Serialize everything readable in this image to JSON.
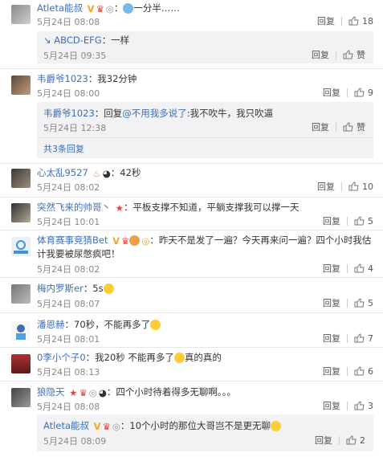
{
  "comments": [
    {
      "name": "Atleta能叔",
      "text": "：",
      "tail": "一分半……",
      "time": "5月24日 08:08",
      "reply": "回复",
      "likes": "18"
    },
    {
      "sub_name": "ABCD-EFG",
      "sub_text": "：一样",
      "sub_time": "5月24日 09:35",
      "reply": "回复",
      "likes": "赞"
    },
    {
      "name": "韦爵爷1023",
      "text": "：我32分钟",
      "time": "5月24日 08:00",
      "reply": "回复",
      "likes": "9"
    },
    {
      "sub_name": "韦爵爷1023",
      "sub_pre": "：回复",
      "sub_at": "@不用我多说了",
      "sub_text": ":我不吹牛，我只吹逼",
      "sub_time": "5月24日 12:38",
      "reply": "回复",
      "likes": "赞",
      "more": "共3条回复"
    },
    {
      "name": "心太乱9527",
      "text": "：42秒",
      "time": "5月24日 08:02",
      "reply": "回复",
      "likes": "10"
    },
    {
      "name": "突然飞来的帅哥丶",
      "text": "：平板支撑不知道，平躺支撑我可以撑一天",
      "time": "5月24日 10:01",
      "reply": "回复",
      "likes": "5"
    },
    {
      "name": "体育赛事竞猜Bet",
      "text": "：昨天不是发了一遍？今天再来问一遍？四个小时我估计我要被尿憋疯吧！",
      "time": "5月24日 08:02",
      "reply": "回复",
      "likes": "4"
    },
    {
      "name": "梅内罗斯er",
      "text": "：5s",
      "time": "5月24日 08:07",
      "reply": "回复",
      "likes": "5"
    },
    {
      "name": "潘恩赫",
      "text": "：70秒，不能再多了",
      "time": "5月24日 08:01",
      "reply": "回复",
      "likes": "7"
    },
    {
      "name": "0李小个子0",
      "text": "：我20秒 不能再多了",
      "tail": "真的真的",
      "time": "5月24日 08:13",
      "reply": "回复",
      "likes": "6"
    },
    {
      "name": "狼隐天",
      "text": "：四个小时待着得多无聊啊。。。",
      "time": "5月24日 08:08",
      "reply": "回复",
      "likes": "3"
    },
    {
      "sub_name": "Atleta能叔",
      "sub_text": "：10个小时的那位大哥岂不是更无聊",
      "sub_time": "5月24日 08:09",
      "reply": "回复",
      "likes": "2"
    }
  ]
}
